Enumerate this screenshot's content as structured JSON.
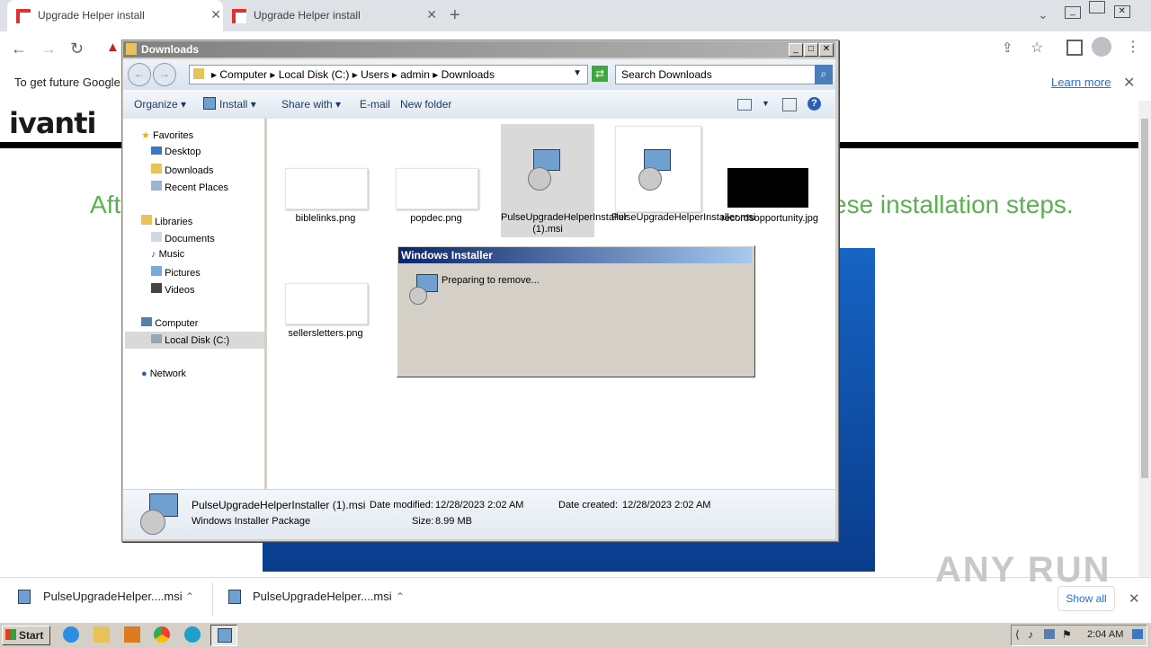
{
  "browser": {
    "tabs": [
      {
        "title": "Upgrade Helper install",
        "active": true
      },
      {
        "title": "Upgrade Helper install",
        "active": false
      }
    ],
    "new_tab": "+",
    "infobar_text": "To get future Google",
    "learn_more": "Learn more"
  },
  "page": {
    "logo": "ivanti",
    "headline_left": "Aft",
    "headline_right": "ese installation steps."
  },
  "explorer": {
    "title": "Downloads",
    "breadcrumb": [
      "Computer",
      "Local Disk (C:)",
      "Users",
      "admin",
      "Downloads"
    ],
    "search_placeholder": "Search Downloads",
    "commands": {
      "organize": "Organize",
      "install": "Install",
      "share_with": "Share with",
      "email": "E-mail",
      "new_folder": "New folder"
    },
    "nav": {
      "favorites": "Favorites",
      "desktop": "Desktop",
      "downloads": "Downloads",
      "recent": "Recent Places",
      "libraries": "Libraries",
      "documents": "Documents",
      "music": "Music",
      "pictures": "Pictures",
      "videos": "Videos",
      "computer": "Computer",
      "local_disk": "Local Disk (C:)",
      "network": "Network"
    },
    "files": [
      {
        "name": "biblelinks.png"
      },
      {
        "name": "popdec.png"
      },
      {
        "name": "PulseUpgradeHelperInstaller (1).msi"
      },
      {
        "name": "PulseUpgradeHelperInstaller.msi"
      },
      {
        "name": "recordsopportunity.jpg"
      },
      {
        "name": "sellersletters.png"
      }
    ],
    "details": {
      "filename": "PulseUpgradeHelperInstaller (1).msi",
      "type": "Windows Installer Package",
      "modified_label": "Date modified:",
      "modified": "12/28/2023 2:02 AM",
      "created_label": "Date created:",
      "created": "12/28/2023 2:02 AM",
      "size_label": "Size:",
      "size": "8.99 MB"
    }
  },
  "installer": {
    "title": "Windows Installer",
    "status": "Preparing to remove..."
  },
  "downloads_shelf": {
    "items": [
      {
        "name": "PulseUpgradeHelper....msi"
      },
      {
        "name": "PulseUpgradeHelper....msi"
      }
    ],
    "show_all": "Show all"
  },
  "taskbar": {
    "start": "Start",
    "clock": "2:04 AM"
  },
  "watermark": "ANY RUN"
}
